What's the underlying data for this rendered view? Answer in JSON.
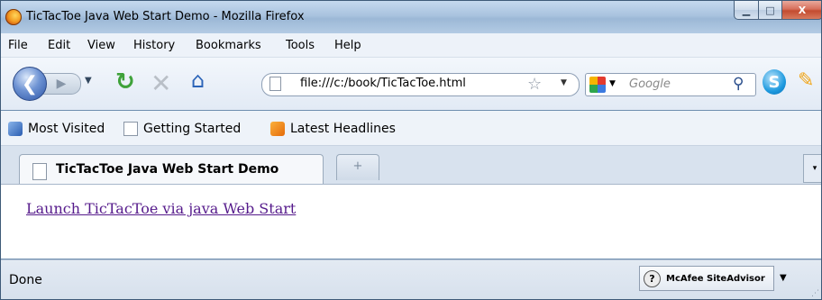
{
  "window": {
    "title": "TicTacToe Java Web Start Demo - Mozilla Firefox"
  },
  "window_controls": {
    "minimize": "▁",
    "maximize": "□",
    "close": "X"
  },
  "menu": {
    "items": [
      {
        "label": "File"
      },
      {
        "label": "Edit"
      },
      {
        "label": "View"
      },
      {
        "label": "History"
      },
      {
        "label": "Bookmarks"
      },
      {
        "label": "Tools"
      },
      {
        "label": "Help"
      }
    ]
  },
  "navigation": {
    "url": "file:///c:/book/TicTacToe.html",
    "search_placeholder": "Google",
    "icons": [
      "back-arrow-icon",
      "forward-arrow-icon",
      "reload-icon",
      "stop-icon",
      "home-icon",
      "page-icon",
      "bookmark-star-icon",
      "google-icon",
      "search-icon",
      "skype-icon",
      "pin-icon"
    ]
  },
  "bookmarks": {
    "items": [
      {
        "label": "Most Visited",
        "icon": "most-visited-icon"
      },
      {
        "label": "Getting Started",
        "icon": "document-icon"
      },
      {
        "label": "Latest Headlines",
        "icon": "rss-icon"
      }
    ]
  },
  "tabs": {
    "active_label": "TicTacToe Java Web Start Demo",
    "new_tab_symbol": "+",
    "list_symbol": "▾"
  },
  "content": {
    "link_text": "Launch TicTacToe via java Web Start"
  },
  "status": {
    "text": "Done",
    "siteadvisor_label": "McAfee SiteAdvisor",
    "siteadvisor_symbol": "?"
  },
  "colors": {
    "visited_link": "#551a8b",
    "titlebar": "#a9c3df",
    "close_button": "#c34b2f"
  }
}
